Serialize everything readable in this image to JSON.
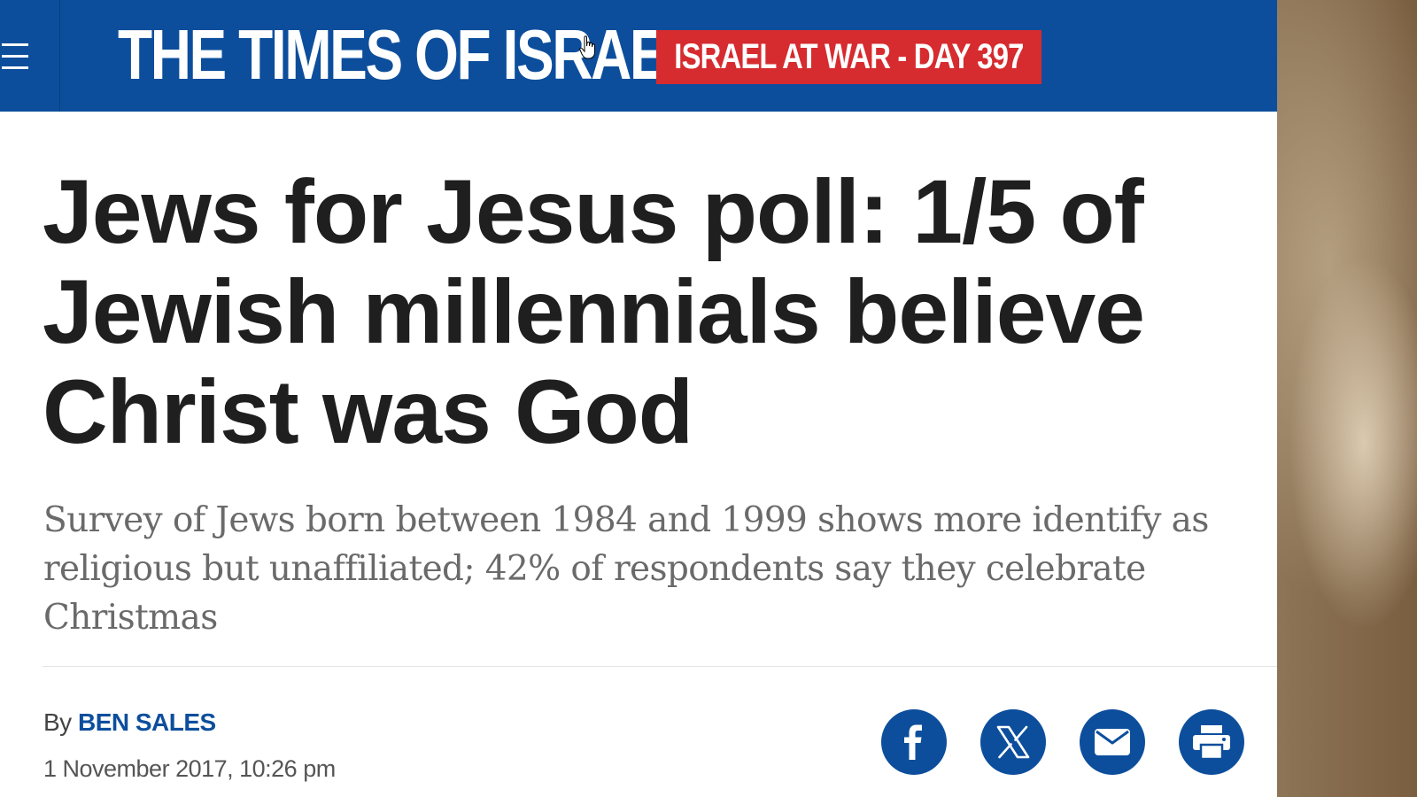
{
  "header": {
    "logo_text": "THE TIMES OF ISRAEL",
    "war_badge": "ISRAEL AT WAR - DAY 397",
    "brand_color": "#0d4e9c",
    "badge_color": "#d62b2f"
  },
  "article": {
    "headline": "Jews for Jesus poll: 1/5 of Jewish millennials believe Christ was God",
    "subheadline": "Survey of Jews born between 1984 and 1999 shows more identify as religious but unaffiliated; 42% of respondents say they celebrate Christmas",
    "byline_prefix": "By",
    "author": "BEN SALES",
    "date": "1 November 2017, 10:26 pm"
  },
  "share": {
    "icons": [
      "facebook-icon",
      "x-icon",
      "email-icon",
      "print-icon"
    ]
  }
}
